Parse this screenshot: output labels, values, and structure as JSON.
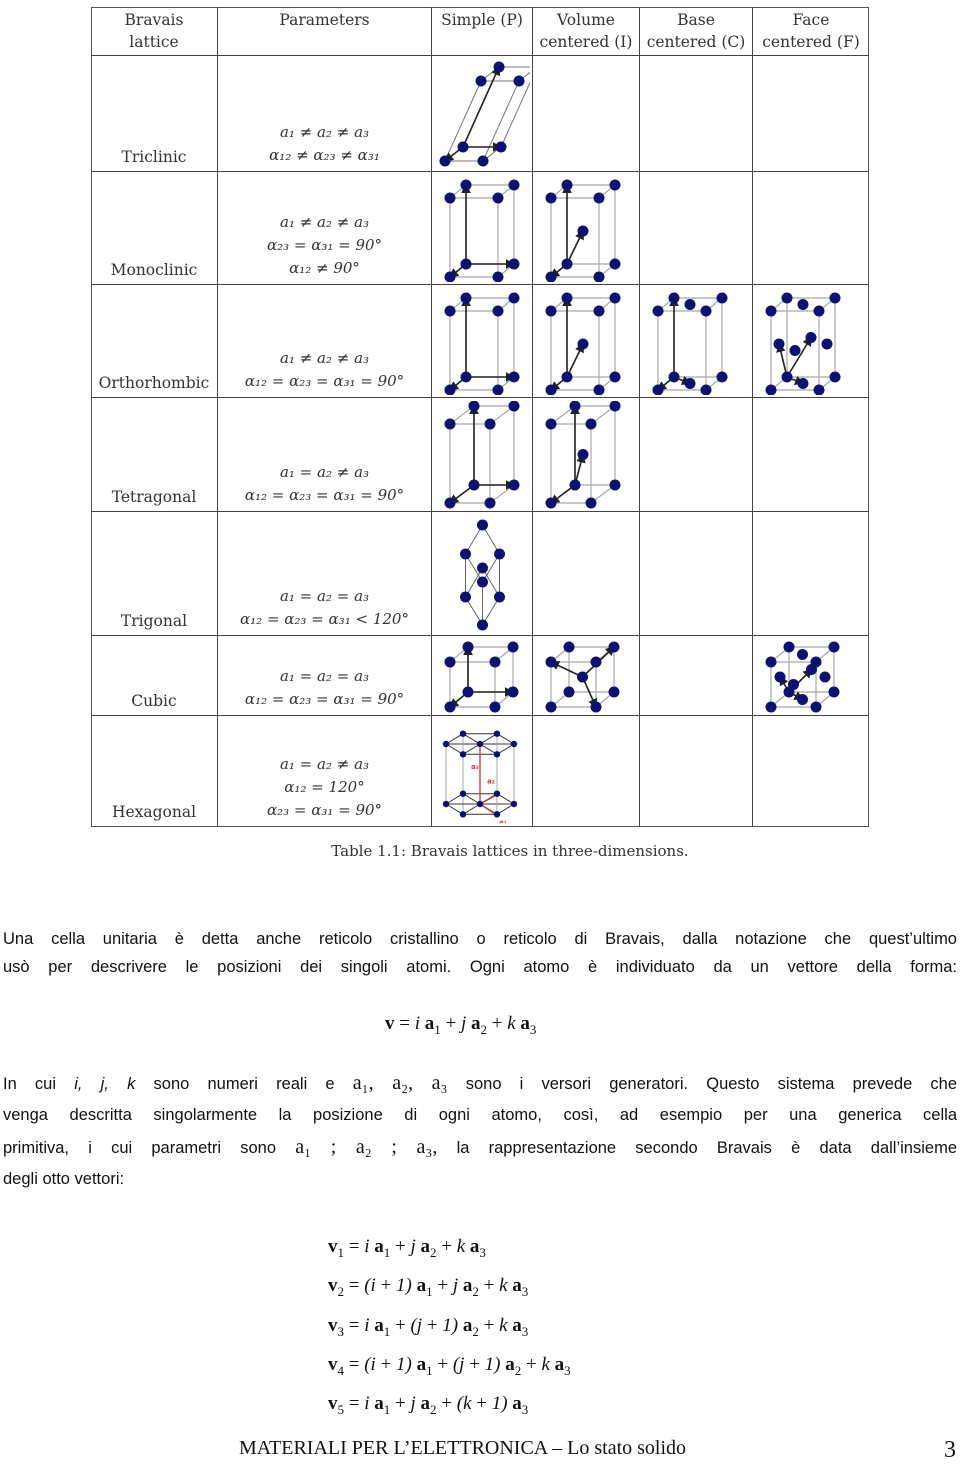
{
  "table": {
    "headers": [
      "Bravais\nlattice",
      "Parameters",
      "Simple (P)",
      "Volume\ncentered (I)",
      "Base\ncentered (C)",
      "Face\ncentered (F)"
    ],
    "rows": [
      {
        "lattice": "Triclinic",
        "parameters": [
          "a₁ ≠ a₂ ≠ a₃",
          "α₁₂ ≠ α₂₃ ≠ α₃₁"
        ],
        "cells": [
          "triclinic-P",
          null,
          null,
          null
        ]
      },
      {
        "lattice": "Monoclinic",
        "parameters": [
          "a₁ ≠ a₂ ≠ a₃",
          "α₂₃ = α₃₁ = 90°",
          "α₁₂ ≠ 90°"
        ],
        "cells": [
          "monoclinic-P",
          "monoclinic-I",
          null,
          null
        ]
      },
      {
        "lattice": "Orthorhombic",
        "parameters": [
          "a₁ ≠ a₂ ≠ a₃",
          "α₁₂ = α₂₃ = α₃₁ = 90°"
        ],
        "cells": [
          "orthorhombic-P",
          "orthorhombic-I",
          "orthorhombic-C",
          "orthorhombic-F"
        ]
      },
      {
        "lattice": "Tetragonal",
        "parameters": [
          "a₁ = a₂ ≠ a₃",
          "α₁₂ = α₂₃ = α₃₁ = 90°"
        ],
        "cells": [
          "tetragonal-P",
          "tetragonal-I",
          null,
          null
        ]
      },
      {
        "lattice": "Trigonal",
        "parameters": [
          "a₁ = a₂ = a₃",
          "α₁₂ = α₂₃ = α₃₁ < 120°"
        ],
        "cells": [
          "trigonal-P",
          null,
          null,
          null
        ]
      },
      {
        "lattice": "Cubic",
        "parameters": [
          "a₁ = a₂ = a₃",
          "α₁₂ = α₂₃ = α₃₁ = 90°"
        ],
        "cells": [
          "cubic-P",
          "cubic-I",
          null,
          "cubic-F"
        ]
      },
      {
        "lattice": "Hexagonal",
        "parameters": [
          "a₁ = a₂ ≠ a₃",
          "α₁₂ = 120°",
          "α₂₃ = α₃₁ = 90°"
        ],
        "cells": [
          "hexagonal-P",
          null,
          null,
          null
        ]
      }
    ],
    "caption": "Table 1.1: Bravais lattices in three-dimensions.",
    "hex_labels": [
      "a₃",
      "a₂",
      "a₁"
    ],
    "colors": {
      "atom": "#0d1170",
      "edge": "#a8a8a8",
      "vector": "#222222",
      "hex_vector": "#d23a3a"
    }
  },
  "text": {
    "para1_line1": "Una cella unitaria è detta anche reticolo cristallino o reticolo di Bravais, dalla notazione che quest’ultimo",
    "para1_line2": "usò per descrivere le posizioni dei singoli atomi. Ogni atomo è individuato da un vettore della forma:",
    "main_equation": "v = i a₁ + j a₂ + k a₃",
    "para2_line1_a": "In cui",
    "para2_vars": "i, j, k",
    "para2_line1_b": "sono numeri reali e",
    "para2_vectors1": "a₁, a₂, a₃",
    "para2_line1_c": "sono i versori generatori. Questo sistema prevede che",
    "para2_line2": "venga descritta singolarmente la posizione di ogni atomo, così, ad esempio per una generica cella",
    "para2_line3_a": "primitiva, i cui parametri sono",
    "para2_vectors2": "a₁ ; a₂ ; a₃,",
    "para2_line3_b": "la rappresentazione secondo Bravais è data dall’insieme",
    "para2_line4": "degli otto vettori:"
  },
  "vectors": [
    {
      "lhs": "v",
      "sub": "1",
      "rhs": [
        [
          "i",
          " a",
          "1"
        ],
        [
          " + j",
          " a",
          "2"
        ],
        [
          " + k",
          " a",
          "3"
        ]
      ]
    },
    {
      "lhs": "v",
      "sub": "2",
      "rhs": [
        [
          "(i + 1)",
          " a",
          "1"
        ],
        [
          " + j",
          " a",
          "2"
        ],
        [
          " + k",
          " a",
          "3"
        ]
      ]
    },
    {
      "lhs": "v",
      "sub": "3",
      "rhs": [
        [
          "i",
          " a",
          "1"
        ],
        [
          " + (j + 1)",
          " a",
          "2"
        ],
        [
          " + k",
          " a",
          "3"
        ]
      ]
    },
    {
      "lhs": "v",
      "sub": "4",
      "rhs": [
        [
          "(i + 1)",
          " a",
          "1"
        ],
        [
          " + (j + 1)",
          " a",
          "2"
        ],
        [
          " + k",
          " a",
          "3"
        ]
      ]
    },
    {
      "lhs": "v",
      "sub": "5",
      "rhs": [
        [
          "i",
          " a",
          "1"
        ],
        [
          " + j",
          " a",
          "2"
        ],
        [
          " + (k + 1)",
          " a",
          "3"
        ]
      ]
    }
  ],
  "footer": {
    "title": "MATERIALI PER L’ELETTRONICA – Lo stato solido",
    "page": "3"
  }
}
